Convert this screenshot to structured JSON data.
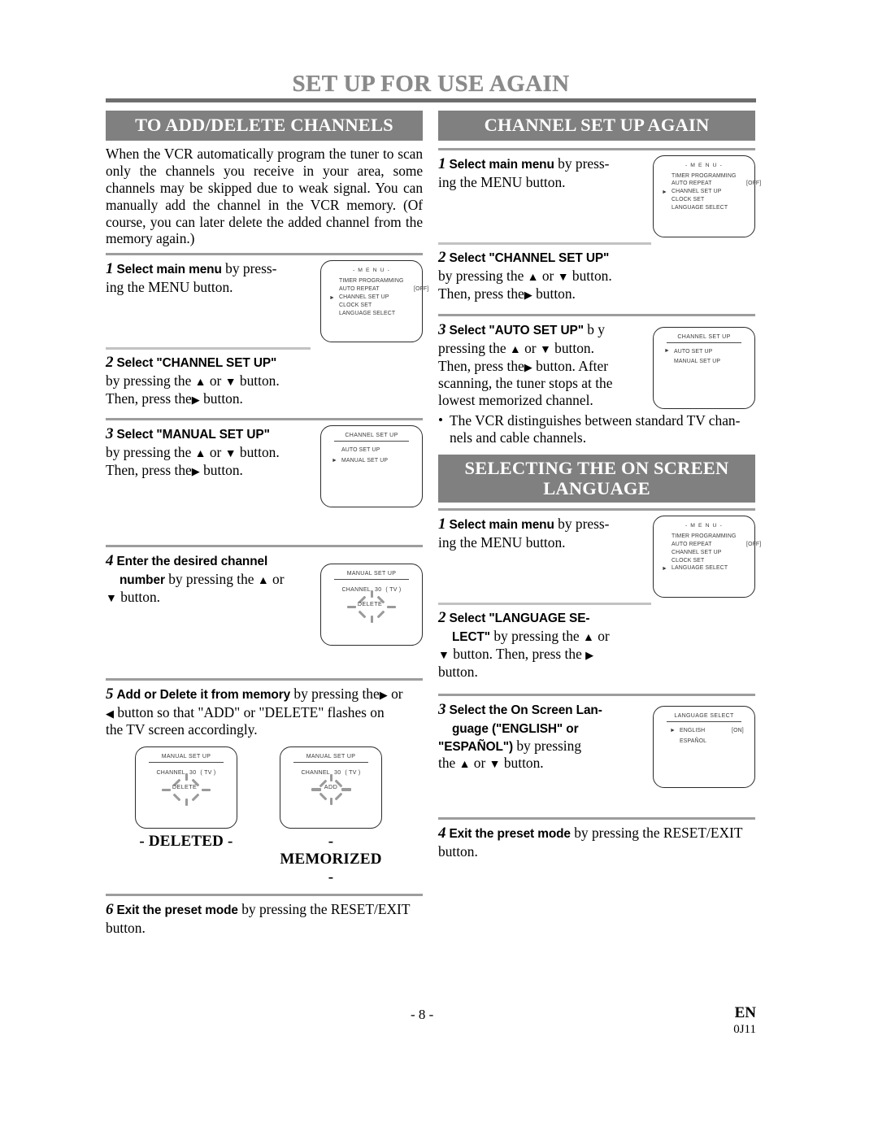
{
  "document": {
    "title": "SET UP FOR USE AGAIN",
    "page_number": "- 8 -",
    "language_code": "EN",
    "part_code": "0J11"
  },
  "left_column": {
    "section_title": "TO ADD/DELETE CHANNELS",
    "intro": "When the VCR automatically program the tuner to scan only the channels you receive in your area, some channels may be skipped due to weak signal. You can manually add the channel in the VCR memory. (Of course, you can later delete the added channel from the memory again.)",
    "steps": [
      {
        "number": "1",
        "bold": "Select main menu",
        "rest_1": " by  press-",
        "rest_2": "ing the MENU button."
      },
      {
        "number": "2",
        "bold": "Select \"CHANNEL SET UP\"",
        "line_2_a": "by pressing the ",
        "line_2_up": "▲",
        "line_2_b": " or ",
        "line_2_down": "▼",
        "line_2_c": " button.",
        "line_3_a": "Then, press the",
        "line_3_right": "▶",
        "line_3_b": " button."
      },
      {
        "number": "3",
        "bold": "Select \"MANUAL SET UP\"",
        "line_2_a": "by pressing the ",
        "line_2_up": "▲",
        "line_2_b": " or ",
        "line_2_down": "▼",
        "line_2_c": " button.",
        "line_3_a": "Then, press the",
        "line_3_right": "▶",
        "line_3_b": " button."
      },
      {
        "number": "4",
        "bold_1": "Enter the desired channel",
        "bold_2": "number",
        "rest_a": " by pressing the ",
        "up": "▲",
        "rest_b": " or",
        "down": "▼",
        "rest_c": " button."
      },
      {
        "number": "5",
        "bold": "Add or Delete it from memory",
        "rest_a": " by pressing the",
        "right": "▶",
        "rest_b": " or",
        "left": "◀",
        "rest_c": " button so that \"ADD\" or \"DELETE\" flashes on",
        "rest_d": "the TV screen accordingly."
      },
      {
        "number": "6",
        "bold": "Exit the preset mode",
        "rest_a": " by pressing the RESET/EXIT",
        "rest_b": "button."
      }
    ],
    "captions": {
      "deleted": "- DELETED -",
      "memorized": "- MEMORIZED -"
    }
  },
  "right_column": {
    "section_title_1": "CHANNEL SET UP AGAIN",
    "section_title_2_line1": "SELECTING THE ON SCREEN",
    "section_title_2_line2": "LANGUAGE",
    "channel_steps": [
      {
        "number": "1",
        "bold": "Select main menu",
        "rest_1": " by  press-",
        "rest_2": "ing the MENU button."
      },
      {
        "number": "2",
        "bold": "Select \"CHANNEL SET UP\"",
        "line_2_a": "by pressing the ",
        "line_2_up": "▲",
        "line_2_b": " or ",
        "line_2_down": "▼",
        "line_2_c": " button.",
        "line_3_a": "Then, press the",
        "line_3_right": "▶",
        "line_3_b": " button."
      },
      {
        "number": "3",
        "bold": "Select \"AUTO SET UP\"",
        "after_bold": "   b y",
        "line_2_a": "pressing  the  ",
        "line_2_up": "▲",
        "line_2_b": "  or  ",
        "line_2_down": "▼",
        "line_2_c": "  button.",
        "line_3_a": "Then, press the",
        "line_3_right": "▶",
        "line_3_b": " button. After",
        "line_4": "scanning, the tuner stops at the",
        "line_5": "lowest memorized channel."
      }
    ],
    "channel_note_1": "The VCR distinguishes between standard TV chan-",
    "channel_note_2": "nels and cable channels.",
    "language_steps": [
      {
        "number": "1",
        "bold": "Select main menu",
        "rest_1": " by  press-",
        "rest_2": "ing the MENU button."
      },
      {
        "number": "2",
        "bold_1": "Select  \"LANGUAGE  SE-",
        "bold_2": "LECT\"",
        "line_2_a": " by pressing the ",
        "line_2_up": "▲",
        "line_2_b": " or",
        "line_3_down": "▼",
        "line_3_a": " button.  Then,  press  the  ",
        "line_3_right": "▶",
        "line_4": "button."
      },
      {
        "number": "3",
        "bold_1": "Select the On Screen Lan-",
        "bold_2": "guage   (\"ENGLISH\"    or",
        "bold_3": "\"ESPAÑOL\")",
        "rest_a": " by  pressing",
        "line_4_a": "the ",
        "up": "▲",
        "line_4_b": " or ",
        "down": "▼",
        "line_4_c": " button."
      },
      {
        "number": "4",
        "bold": "Exit the preset mode",
        "rest_a": " by pressing the RESET/EXIT",
        "rest_b": "button."
      }
    ]
  },
  "osd_screens": {
    "main_menu_channel": {
      "title": "- M E N U -",
      "items": [
        {
          "label": "TIMER PROGRAMMING",
          "value": "",
          "cursor": false
        },
        {
          "label": "AUTO REPEAT",
          "value": "[OFF]",
          "cursor": false
        },
        {
          "label": "CHANNEL SET UP",
          "value": "",
          "cursor": true
        },
        {
          "label": "CLOCK SET",
          "value": "",
          "cursor": false
        },
        {
          "label": "LANGUAGE SELECT",
          "value": "",
          "cursor": false
        }
      ]
    },
    "main_menu_language": {
      "title": "- M E N U -",
      "items": [
        {
          "label": "TIMER PROGRAMMING",
          "value": "",
          "cursor": false
        },
        {
          "label": "AUTO REPEAT",
          "value": "[OFF]",
          "cursor": false
        },
        {
          "label": "CHANNEL SET UP",
          "value": "",
          "cursor": false
        },
        {
          "label": "CLOCK SET",
          "value": "",
          "cursor": false
        },
        {
          "label": "LANGUAGE SELECT",
          "value": "",
          "cursor": true
        }
      ]
    },
    "channel_set_up_manual": {
      "title": "CHANNEL SET UP",
      "items": [
        {
          "label": "AUTO SET UP",
          "cursor": false
        },
        {
          "label": "MANUAL SET UP",
          "cursor": true
        }
      ]
    },
    "channel_set_up_auto": {
      "title": "CHANNEL SET UP",
      "items": [
        {
          "label": "AUTO SET UP",
          "cursor": true
        },
        {
          "label": "MANUAL SET UP",
          "cursor": false
        }
      ]
    },
    "manual_set_up_delete": {
      "title": "MANUAL SET UP",
      "channel_label": "CHANNEL",
      "channel_number": "30",
      "channel_type": "( TV )",
      "flash_word": "DELETE"
    },
    "manual_set_up_add": {
      "title": "MANUAL SET UP",
      "channel_label": "CHANNEL",
      "channel_number": "30",
      "channel_type": "( TV )",
      "flash_word": "ADD"
    },
    "language_select": {
      "title": "LANGUAGE SELECT",
      "items": [
        {
          "label": "ENGLISH",
          "value": "[ON]",
          "cursor": true
        },
        {
          "label": "ESPAÑOL",
          "value": "",
          "cursor": false
        }
      ]
    }
  },
  "colors": {
    "header_bar": "#808080",
    "title_text": "#8a8a8a",
    "rule": "#9d9d9d"
  }
}
